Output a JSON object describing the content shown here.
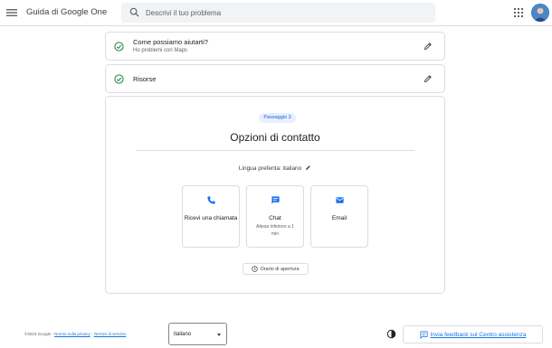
{
  "header": {
    "title": "Guida di Google One",
    "search_placeholder": "Descrivi il tuo problema"
  },
  "steps": [
    {
      "title": "Come possiamo aiutarti?",
      "subtitle": "Ho problemi con Maps"
    },
    {
      "title": "Risorse"
    }
  ],
  "contact": {
    "badge": "Passaggio 3",
    "title": "Opzioni di contatto",
    "language_label": "Lingua preferita:",
    "language_value": "italiano",
    "options": [
      {
        "label": "Ricevi una chiamata",
        "icon": "phone-icon"
      },
      {
        "label": "Chat",
        "sub": "Attesa inferiore a 1 min",
        "icon": "chat-icon"
      },
      {
        "label": "Email",
        "icon": "email-icon"
      }
    ],
    "hours_button": "Orario di apertura"
  },
  "footer": {
    "copyright": "©2023 Google -",
    "privacy": "Norme sulla privacy",
    "separator": "-",
    "terms": "Termini di servizio",
    "language_select": "italiano",
    "feedback": "Invia feedback sul Centro assistenza"
  },
  "colors": {
    "accent": "#1a73e8",
    "success": "#188038",
    "badge_bg": "#e8f0fe",
    "border": "#dadce0"
  }
}
